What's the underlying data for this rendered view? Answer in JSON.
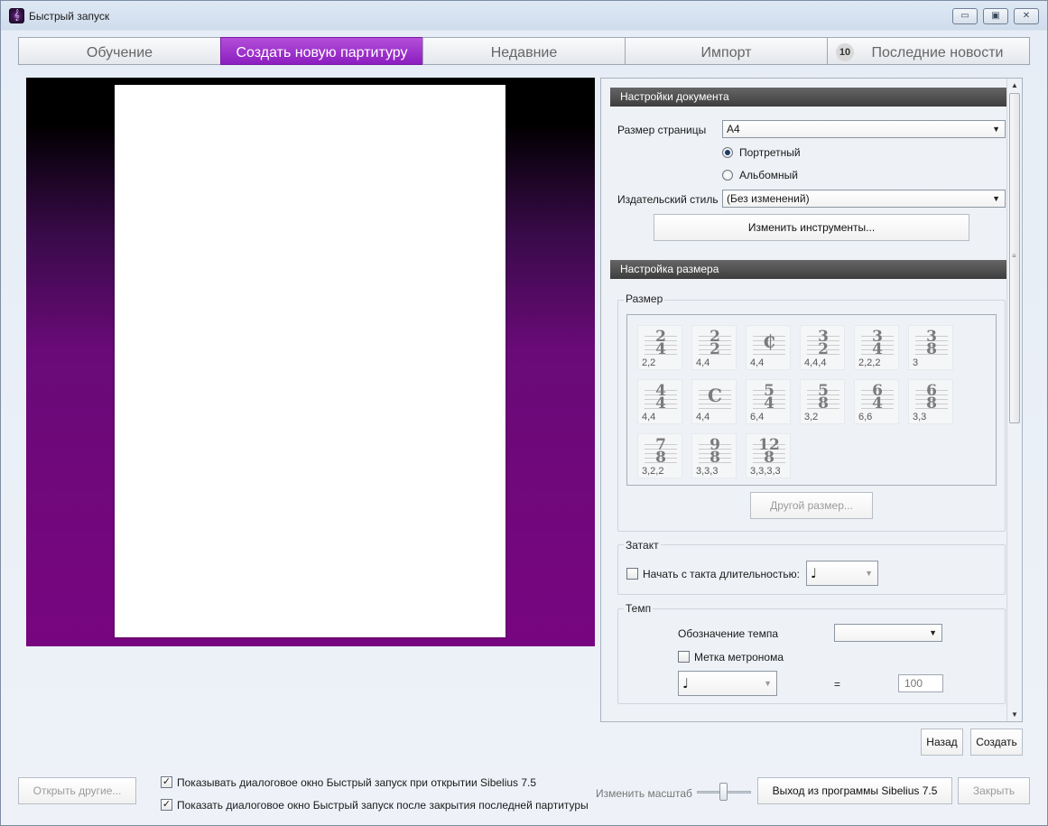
{
  "window": {
    "title": "Быстрый запуск",
    "icon": "sibelius-app-icon",
    "controls": {
      "minimize": "▭",
      "restore": "▣",
      "close": "✕"
    }
  },
  "tabs": [
    {
      "label": "Обучение"
    },
    {
      "label": "Создать новую партитуру"
    },
    {
      "label": "Недавние"
    },
    {
      "label": "Импорт"
    },
    {
      "label": "Последние новости",
      "badge": "10"
    }
  ],
  "doc": {
    "header": "Настройки документа",
    "page_size_label": "Размер страницы",
    "page_size_value": "A4",
    "portrait": "Портретный",
    "landscape": "Альбомный",
    "style_label": "Издательский стиль",
    "style_value": "(Без изменений)",
    "change_instruments": "Изменить инструменты..."
  },
  "size": {
    "header": "Настройка размера",
    "group": "Размер",
    "timesigs": [
      {
        "top": "2",
        "bot": "4",
        "group": "2,2"
      },
      {
        "top": "2",
        "bot": "2",
        "group": "4,4"
      },
      {
        "sym": "₵",
        "group": "4,4"
      },
      {
        "top": "3",
        "bot": "2",
        "group": "4,4,4"
      },
      {
        "top": "3",
        "bot": "4",
        "group": "2,2,2"
      },
      {
        "top": "3",
        "bot": "8",
        "group": "3"
      },
      {
        "top": "4",
        "bot": "4",
        "group": "4,4"
      },
      {
        "sym": "C",
        "group": "4,4"
      },
      {
        "top": "5",
        "bot": "4",
        "group": "6,4"
      },
      {
        "top": "5",
        "bot": "8",
        "group": "3,2"
      },
      {
        "top": "6",
        "bot": "4",
        "group": "6,6"
      },
      {
        "top": "6",
        "bot": "8",
        "group": "3,3"
      },
      {
        "top": "7",
        "bot": "8",
        "group": "3,2,2"
      },
      {
        "top": "9",
        "bot": "8",
        "group": "3,3,3"
      },
      {
        "top": "12",
        "bot": "8",
        "group": "3,3,3,3"
      }
    ],
    "other": "Другой размер..."
  },
  "pickup": {
    "group": "Затакт",
    "label": "Начать с такта длительностью:",
    "note": "♩"
  },
  "tempo": {
    "group": "Темп",
    "marking_label": "Обозначение темпа",
    "marking_value": "",
    "metronome_label": "Метка метронома",
    "note": "♩",
    "equals": "=",
    "bpm": "100"
  },
  "actions": {
    "back": "Назад",
    "create": "Создать"
  },
  "footer": {
    "open_other": "Открыть другие...",
    "show_on_open": "Показывать диалоговое окно Быстрый запуск при открытии Sibelius 7.5",
    "show_after_close": "Показать диалоговое окно Быстрый запуск после закрытия последней партитуры",
    "zoom_label": "Изменить масштаб",
    "zoom_level": 0.5,
    "exit": "Выход из программы Sibelius 7.5",
    "close": "Закрыть"
  },
  "colors": {
    "accent": "#8c1ec0",
    "header": "#4a4a4a"
  }
}
